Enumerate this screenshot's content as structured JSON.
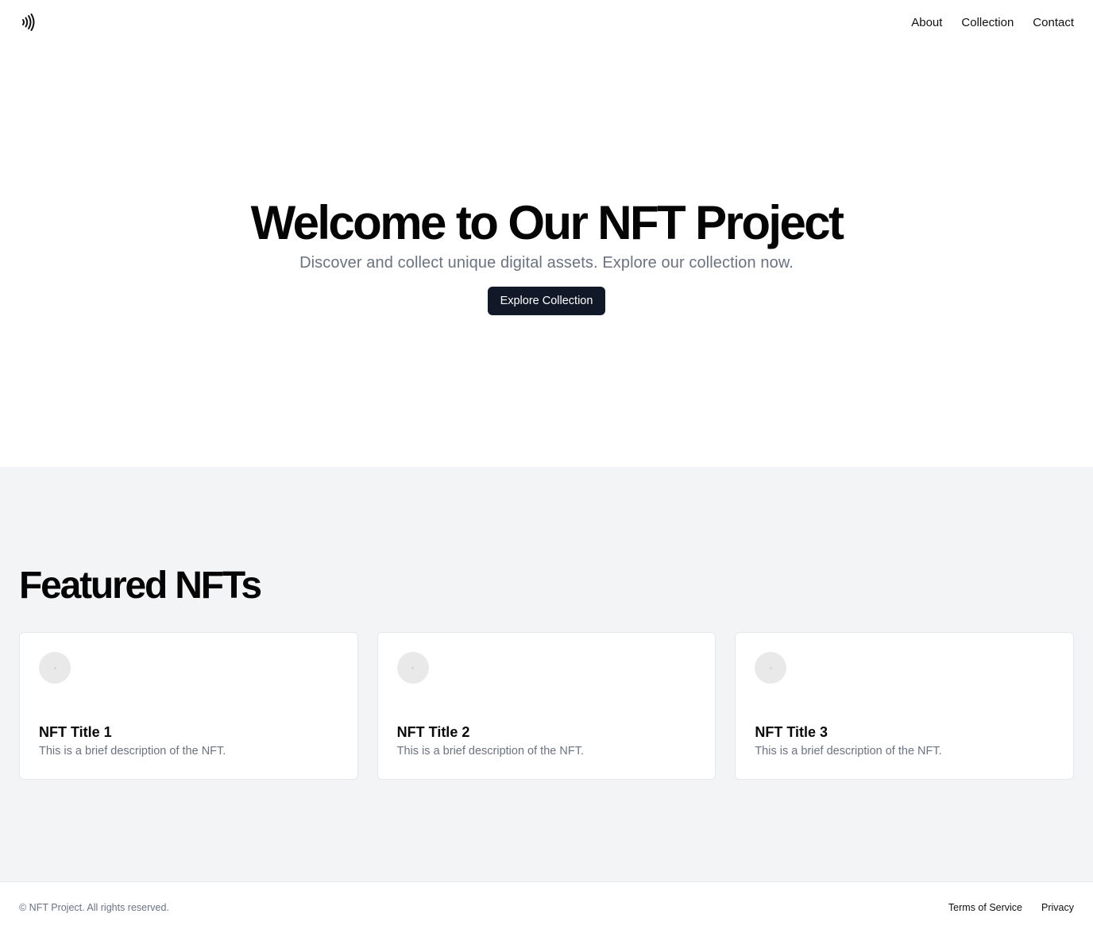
{
  "header": {
    "logo_icon": "contactless-wave-icon",
    "nav": [
      {
        "label": "About"
      },
      {
        "label": "Collection"
      },
      {
        "label": "Contact"
      }
    ]
  },
  "hero": {
    "title": "Welcome to Our NFT Project",
    "subtitle": "Discover and collect unique digital assets. Explore our collection now.",
    "button_label": "Explore Collection"
  },
  "featured": {
    "title": "Featured NFTs",
    "cards": [
      {
        "title": "NFT Title 1",
        "description": "This is a brief description of the NFT.",
        "image_icon": "placeholder-image-icon"
      },
      {
        "title": "NFT Title 2",
        "description": "This is a brief description of the NFT.",
        "image_icon": "placeholder-image-icon"
      },
      {
        "title": "NFT Title 3",
        "description": "This is a brief description of the NFT.",
        "image_icon": "placeholder-image-icon"
      }
    ]
  },
  "footer": {
    "copyright": "© NFT Project. All rights reserved.",
    "links": [
      {
        "label": "Terms of Service"
      },
      {
        "label": "Privacy"
      }
    ]
  },
  "colors": {
    "primary_button": "#111827",
    "muted_text": "#6b7280",
    "section_background": "#f3f4f6",
    "border": "#e5e7eb"
  }
}
